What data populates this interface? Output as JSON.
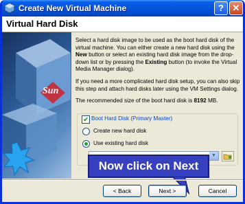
{
  "window": {
    "title": "Create New Virtual Machine",
    "help_glyph": "?",
    "close_glyph": "✕"
  },
  "page": {
    "heading": "Virtual Hard Disk"
  },
  "sidebar": {
    "logo_text": "Sun"
  },
  "description": {
    "p1_a": "Select a hard disk image to be used as the boot hard disk of the virtual machine. You can either create a new hard disk using the ",
    "p1_b": "New",
    "p1_c": " button or select an existing hard disk image from the drop-down list or by pressing the ",
    "p1_d": "Existing",
    "p1_e": " button (to invoke the Virtual Media Manager dialog).",
    "p2": "If you need a more complicated hard disk setup, you can also skip this step and attach hard disks later using the VM Settings dialog.",
    "p3_a": "The recommended size of the boot hard disk is ",
    "p3_b": "8192",
    "p3_c": " MB."
  },
  "boot_disk": {
    "checkbox_label": "Boot Hard Disk (Primary Master)",
    "checked": true,
    "option_create": "Create new hard disk",
    "option_existing": "Use existing hard disk",
    "selected_option": "existing"
  },
  "callout": {
    "text": "Now click on Next"
  },
  "buttons": {
    "back": "< Back",
    "next": "Next >",
    "cancel": "Cancel"
  },
  "colors": {
    "title_bar": "#0555dc",
    "callout": "#3741bf",
    "checkbox_label": "#0046d5"
  }
}
